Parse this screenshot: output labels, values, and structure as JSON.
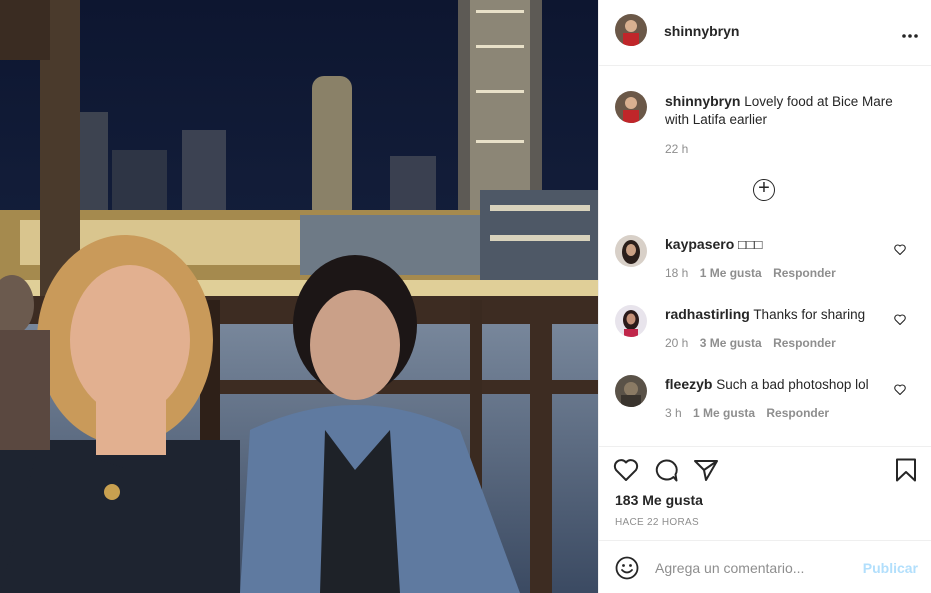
{
  "photo": {
    "alt": ""
  },
  "post": {
    "username": "shinnybryn",
    "caption_user": "shinnybryn",
    "caption_text": "Lovely food at Bice Mare with Latifa earlier",
    "caption_time": "22 h",
    "more_icon": "more-horizontal-icon",
    "load_more_icon": "plus-circle-icon"
  },
  "comments": [
    {
      "user": "kaypasero",
      "text": "□□□",
      "time": "18 h",
      "likes": "1 Me gusta",
      "reply": "Responder"
    },
    {
      "user": "radhastirling",
      "text": "Thanks for sharing",
      "time": "20 h",
      "likes": "3 Me gusta",
      "reply": "Responder"
    },
    {
      "user": "fleezyb",
      "text": "Such a bad photoshop lol",
      "time": "3 h",
      "likes": "1 Me gusta",
      "reply": "Responder"
    }
  ],
  "actions": {
    "like_icon": "heart-icon",
    "comment_icon": "comment-icon",
    "share_icon": "send-icon",
    "save_icon": "bookmark-icon"
  },
  "likes_count": "183 Me gusta",
  "posted_ago": "HACE 22 HORAS",
  "add_comment": {
    "placeholder": "Agrega un comentario...",
    "publish_label": "Publicar",
    "emoji_icon": "smiley-icon"
  },
  "colors": {
    "text": "#262626",
    "muted": "#8e8e8e",
    "publish_disabled": "#b2dffc",
    "divider": "#efefef"
  }
}
